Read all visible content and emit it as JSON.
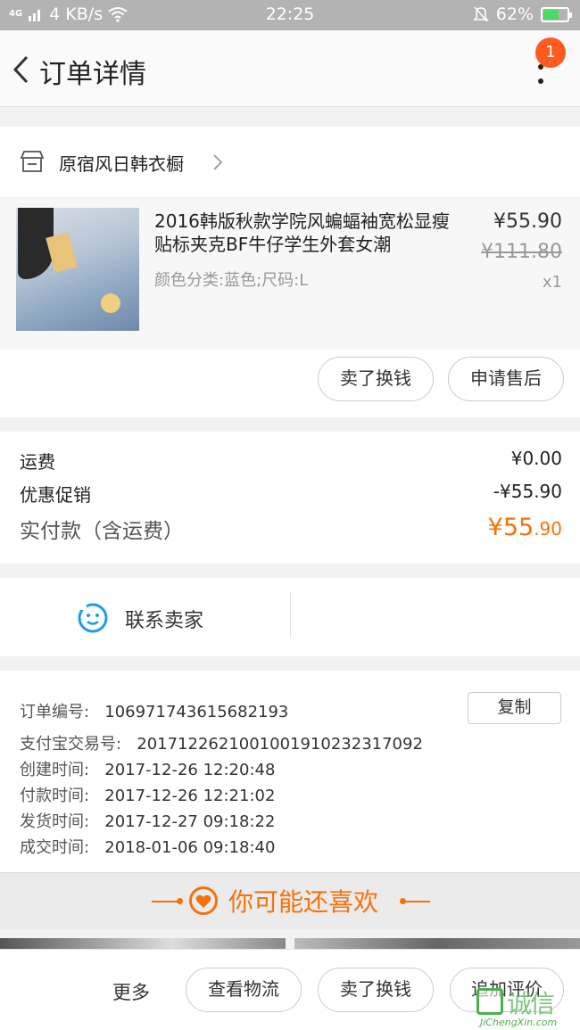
{
  "status_bar": {
    "network": "4G",
    "speed": "4 KB/s",
    "time": "22:25",
    "battery": "62%"
  },
  "nav": {
    "title": "订单详情",
    "badge_count": "1"
  },
  "shop": {
    "name": "原宿风日韩衣橱"
  },
  "product": {
    "title": "2016韩版秋款学院风蝙蝠袖宽松显瘦贴标夹克BF牛仔学生外套女潮",
    "spec": "颜色分类:蓝色;尺码:L",
    "price": "¥55.90",
    "original_price": "¥111.80",
    "quantity": "x1"
  },
  "actions": {
    "sell_exchange": "卖了换钱",
    "after_sale": "申请售后"
  },
  "fees": {
    "shipping_label": "运费",
    "shipping_value": "¥0.00",
    "discount_label": "优惠促销",
    "discount_value": "-¥55.90",
    "total_label": "实付款（含运费）",
    "total_currency_int": "¥55",
    "total_decimal": ".90"
  },
  "contact": {
    "label": "联系卖家"
  },
  "order_info": {
    "order_no_label": "订单编号:",
    "order_no": "106971743615682193",
    "copy_label": "复制",
    "alipay_label": "支付宝交易号:",
    "alipay_no": "2017122621001001910232317092",
    "created_label": "创建时间:",
    "created": "2017-12-26 12:20:48",
    "paid_label": "付款时间:",
    "paid": "2017-12-26 12:21:02",
    "shipped_label": "发货时间:",
    "shipped": "2017-12-27 09:18:22",
    "completed_label": "成交时间:",
    "completed": "2018-01-06 09:18:40"
  },
  "recommend": {
    "title": "你可能还喜欢"
  },
  "bottom_bar": {
    "more": "更多",
    "logistics": "查看物流",
    "sell_exchange": "卖了换钱",
    "add_review": "追加评价"
  },
  "watermark": {
    "text": "诚信",
    "url": "JiChengXin.com"
  },
  "colors": {
    "accent": "#f5720b",
    "badge": "#ff5a1f",
    "status_bar": "#b3b3b3"
  }
}
